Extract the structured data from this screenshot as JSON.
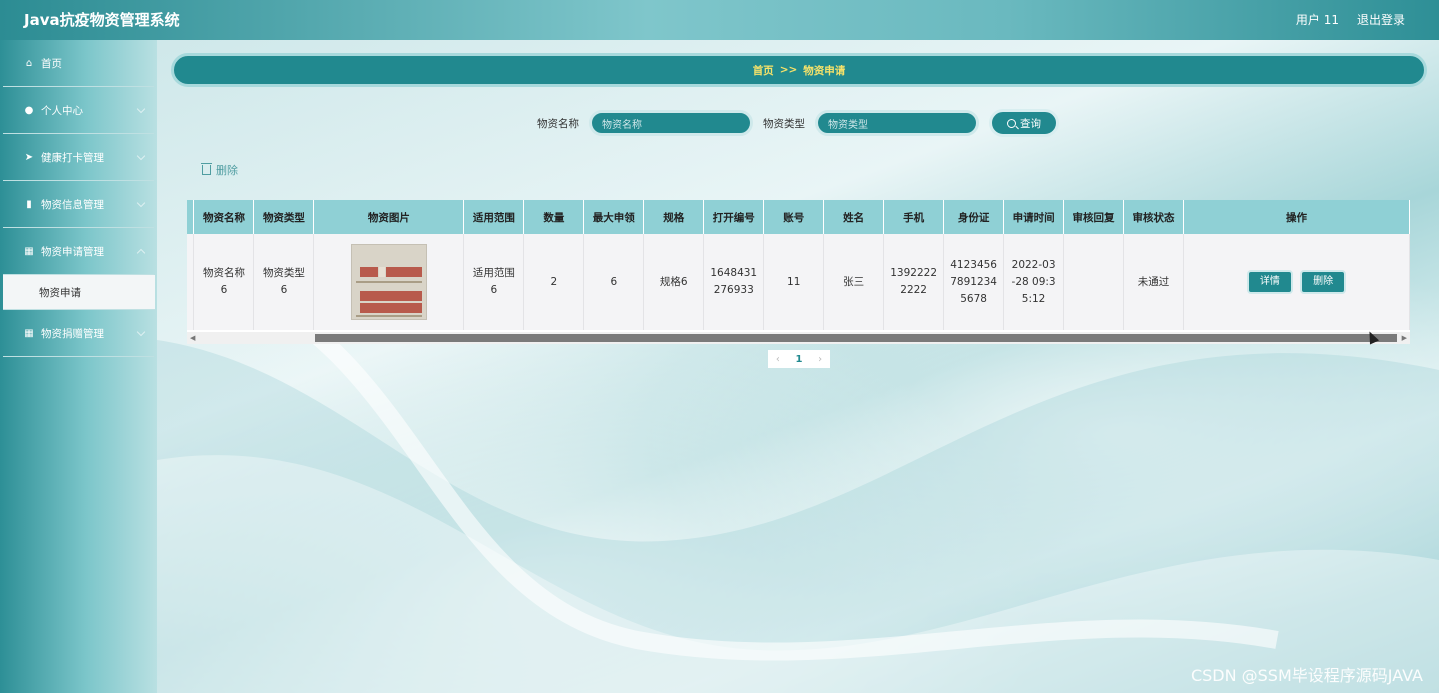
{
  "header": {
    "title": "Java抗疫物资管理系统",
    "user": "用户 11",
    "logout": "退出登录"
  },
  "sidebar": {
    "items": [
      {
        "label": "首页",
        "icon": "home-icon",
        "glyph": "⌂",
        "has_sub": false
      },
      {
        "label": "个人中心",
        "icon": "user-icon",
        "glyph": "●",
        "has_sub": true
      },
      {
        "label": "健康打卡管理",
        "icon": "send-icon",
        "glyph": "➤",
        "has_sub": true
      },
      {
        "label": "物资信息管理",
        "icon": "clipboard-icon",
        "glyph": "▮",
        "has_sub": true
      },
      {
        "label": "物资申请管理",
        "icon": "grid-icon",
        "glyph": "▦",
        "has_sub": true
      },
      {
        "label": "物资申请",
        "submenu": true
      },
      {
        "label": "物资捐赠管理",
        "icon": "grid-icon",
        "glyph": "▦",
        "has_sub": true
      }
    ]
  },
  "breadcrumb": {
    "home": "首页",
    "sep": ">>",
    "current": "物资申请"
  },
  "search": {
    "name_label": "物资名称",
    "name_placeholder": "物资名称",
    "type_label": "物资类型",
    "type_placeholder": "物资类型",
    "query_label": "查询"
  },
  "toolbar": {
    "delete_label": "删除"
  },
  "table": {
    "headers": [
      "物资名称",
      "物资类型",
      "物资图片",
      "适用范围",
      "数量",
      "最大申领",
      "规格",
      "打开编号",
      "账号",
      "姓名",
      "手机",
      "身份证",
      "申请时间",
      "审核回复",
      "审核状态",
      "操作"
    ],
    "rows": [
      {
        "name": "物资名称6",
        "type": "物资类型6",
        "scope": "适用范围6",
        "qty": "2",
        "max": "6",
        "spec": "规格6",
        "open_no": "1648431276933",
        "account": "11",
        "person": "张三",
        "phone": "13922222222",
        "id_card": "412345678912345678",
        "time": "2022-03-28 09:35:12",
        "reply": "",
        "status": "未通过",
        "detail_btn": "详情",
        "delete_btn": "删除"
      }
    ]
  },
  "pager": {
    "prev": "‹",
    "page": "1",
    "next": "›"
  },
  "watermark": "CSDN @SSM毕设程序源码JAVA"
}
